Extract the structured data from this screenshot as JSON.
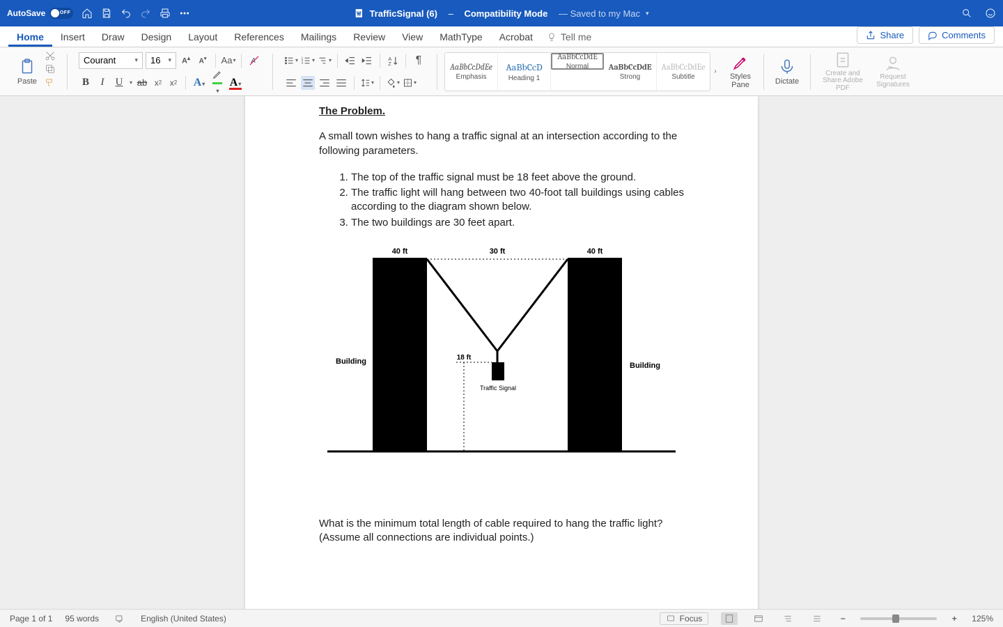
{
  "titlebar": {
    "autosave": "AutoSave",
    "autosave_state": "OFF",
    "filename": "TrafficSignal (6)",
    "dash": "–",
    "mode": "Compatibility Mode",
    "saved": "— Saved to my Mac"
  },
  "tabs": {
    "items": [
      "Home",
      "Insert",
      "Draw",
      "Design",
      "Layout",
      "References",
      "Mailings",
      "Review",
      "View",
      "MathType",
      "Acrobat"
    ],
    "active": 0,
    "tellme": "Tell me",
    "share": "Share",
    "comments": "Comments"
  },
  "ribbon": {
    "paste": "Paste",
    "font_name": "Courant",
    "font_size": "16",
    "styles": [
      {
        "preview": "AaBbCcDdEe",
        "label": "Emphasis"
      },
      {
        "preview": "AaBbCcD",
        "label": "Heading 1"
      },
      {
        "preview": "AaBbCcDdE",
        "label": "Normal"
      },
      {
        "preview": "AaBbCcDdE",
        "label": "Strong"
      },
      {
        "preview": "AaBbCcDdEe",
        "label": "Subtitle"
      }
    ],
    "styles_selected": 2,
    "styles_pane": "Styles Pane",
    "dictate": "Dictate",
    "create_share": "Create and Share Adobe PDF",
    "request_sig": "Request Signatures"
  },
  "document": {
    "heading": "The Problem.",
    "intro": "A small town wishes to hang a traffic signal at an intersection according to the following parameters.",
    "li1": "The top of the traffic signal must be 18 feet above the ground.",
    "li2": "The traffic light will hang between two 40-foot tall buildings using cables according to the diagram shown below.",
    "li3": "The two buildings are 30 feet apart.",
    "diagram": {
      "top_left": "40 ft",
      "top_mid": "30 ft",
      "top_right": "40 ft",
      "height_lbl": "18 ft",
      "building": "Building",
      "signal": "Traffic Signal"
    },
    "question": "What is the minimum total length of cable required to hang the traffic light? (Assume all connections are individual points.)"
  },
  "status": {
    "page": "Page 1 of 1",
    "words": "95 words",
    "lang": "English (United States)",
    "focus": "Focus",
    "zoom": "125%"
  }
}
